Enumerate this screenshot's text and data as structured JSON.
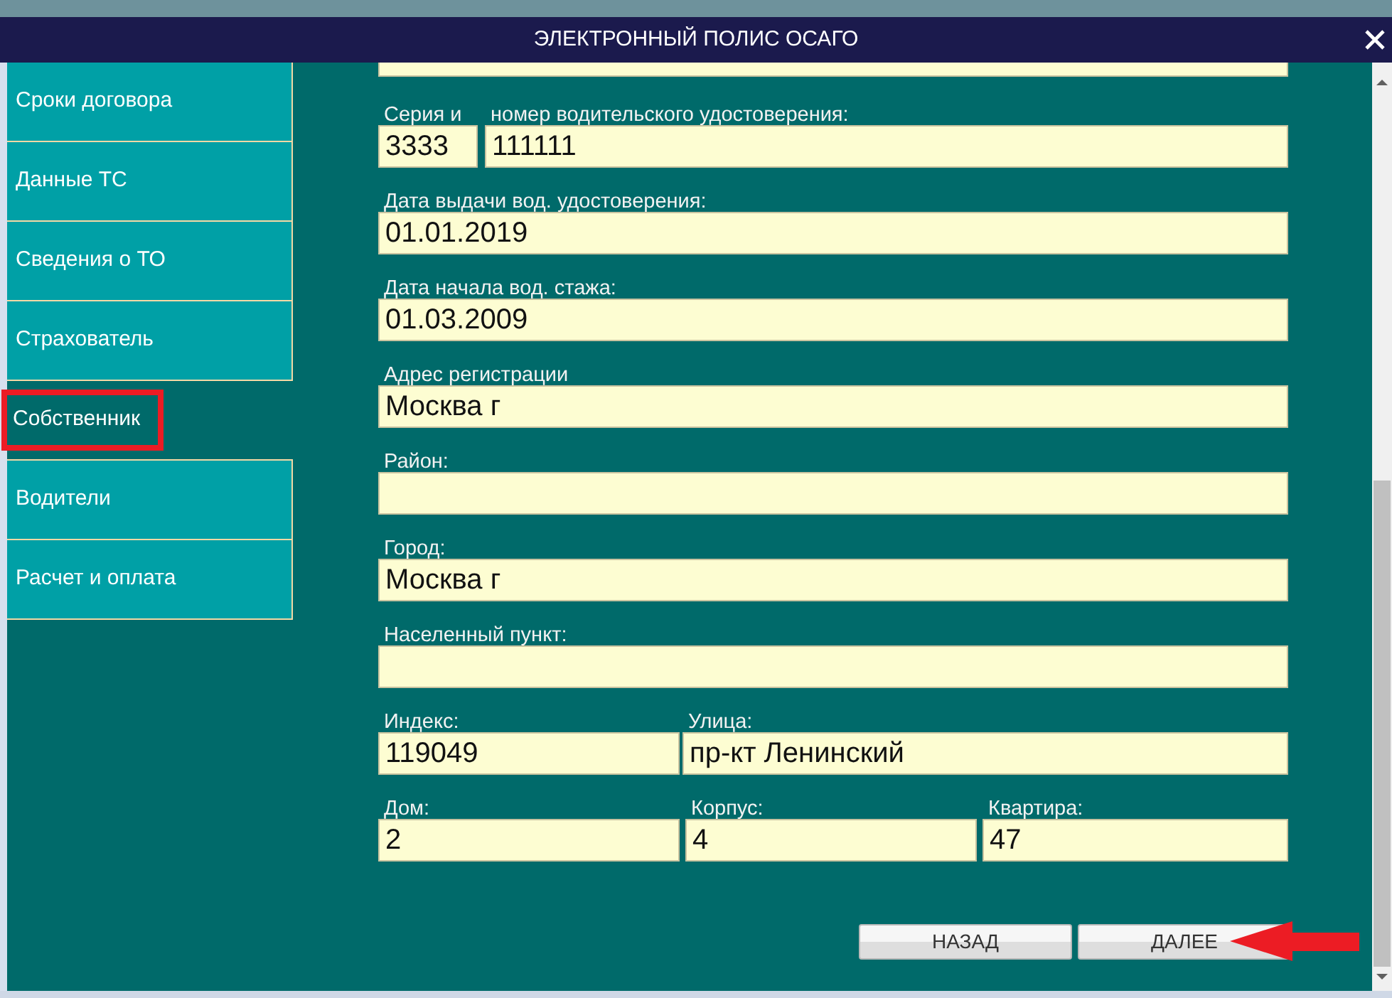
{
  "window": {
    "title": "ЭЛЕКТРОННЫЙ ПОЛИС ОСАГО"
  },
  "sidebar": {
    "items": [
      {
        "label": "Сроки договора",
        "selected": false
      },
      {
        "label": "Данные ТС",
        "selected": false
      },
      {
        "label": "Сведения о ТО",
        "selected": false
      },
      {
        "label": "Страхователь",
        "selected": false
      },
      {
        "label": "Собственник",
        "selected": true
      },
      {
        "label": "Водители",
        "selected": false
      },
      {
        "label": "Расчет и оплата",
        "selected": false
      }
    ]
  },
  "form": {
    "rows": [
      {
        "kind": "series",
        "fields": [
          {
            "label": "Серия и",
            "value": "3333"
          },
          {
            "label": "номер водительского удостоверения:",
            "value": "111111"
          }
        ]
      },
      {
        "kind": "single",
        "fields": [
          {
            "label": "Дата выдачи вод. удостоверения:",
            "value": "01.01.2019"
          }
        ]
      },
      {
        "kind": "single",
        "fields": [
          {
            "label": "Дата начала вод. стажа:",
            "value": "01.03.2009"
          }
        ]
      },
      {
        "kind": "single",
        "fields": [
          {
            "label": "Адрес регистрации",
            "value": "Москва г"
          }
        ]
      },
      {
        "kind": "single",
        "fields": [
          {
            "label": "Район:"
          }
        ]
      },
      {
        "kind": "single",
        "fields": [
          {
            "label": "Город:",
            "value": "Москва г"
          }
        ]
      },
      {
        "kind": "single",
        "fields": [
          {
            "label": "Населенный пункт:"
          }
        ]
      },
      {
        "kind": "address",
        "fields": [
          {
            "label": "Индекс:",
            "value": "119049"
          },
          {
            "label": "Улица:",
            "value": "пр-кт Ленинский"
          }
        ]
      },
      {
        "kind": "house",
        "fields": [
          {
            "label": "Дом:",
            "value": "2"
          },
          {
            "label": "Корпус:",
            "value": "4"
          },
          {
            "label": "Квартира:",
            "value": "47"
          }
        ]
      }
    ]
  },
  "buttons": [
    {
      "label": "НАЗАД"
    },
    {
      "label": "ДАЛЕЕ"
    }
  ]
}
